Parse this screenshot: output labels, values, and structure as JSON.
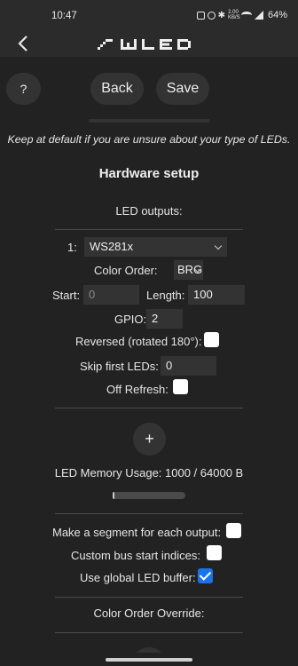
{
  "status": {
    "time": "10:47",
    "net_speed_top": "2.00",
    "net_speed_bottom": "KB/S",
    "battery": "64%"
  },
  "app": {
    "logo_text": "WLED"
  },
  "toolbar": {
    "help_label": "?",
    "back_label": "Back",
    "save_label": "Save"
  },
  "content": {
    "note": "Keep at default if you are unsure about your type of LEDs.",
    "section_title": "Hardware setup",
    "led_outputs_label": "LED outputs:",
    "output": {
      "index_label": "1:",
      "led_type": "WS281x",
      "color_order_label": "Color Order:",
      "color_order": "BRG",
      "start_label": "Start:",
      "start_placeholder": "0",
      "length_label": "Length:",
      "length_value": "100",
      "gpio_label": "GPIO:",
      "gpio_value": "2",
      "reversed_label": "Reversed (rotated 180°):",
      "reversed_checked": false,
      "skip_label": "Skip first LEDs:",
      "skip_value": "0",
      "off_refresh_label": "Off Refresh:",
      "off_refresh_checked": false
    },
    "add_output_label": "+",
    "memory_usage_label": "LED Memory Usage: 1000 / 64000 B",
    "memory_usage_fraction": 0.016,
    "segment_each_label": "Make a segment for each output:",
    "segment_each_checked": false,
    "custom_bus_label": "Custom bus start indices:",
    "custom_bus_checked": false,
    "global_buffer_label": "Use global LED buffer:",
    "global_buffer_checked": true,
    "color_order_override_label": "Color Order Override:"
  },
  "colors": {
    "background": "#222222",
    "control": "#333333",
    "checkbox_checked": "#1a73e8"
  }
}
